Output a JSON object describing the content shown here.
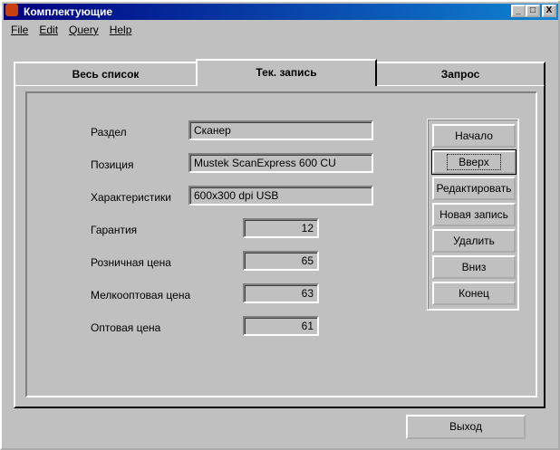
{
  "window": {
    "title": "Комплектующие",
    "minimize": "_",
    "maximize": "□",
    "close": "X"
  },
  "menu": [
    "File",
    "Edit",
    "Query",
    "Help"
  ],
  "tabs": [
    "Весь список",
    "Тек. запись",
    "Запрос"
  ],
  "fields": {
    "section": {
      "label": "Раздел",
      "value": "Сканер"
    },
    "position": {
      "label": "Позиция",
      "value": "Mustek ScanExpress 600 CU"
    },
    "specs": {
      "label": "Характеристики",
      "value": "600x300 dpi USB"
    },
    "warranty": {
      "label": "Гарантия",
      "value": "12"
    },
    "retail": {
      "label": "Розничная цена",
      "value": "65"
    },
    "smallwholesale": {
      "label": "Мелкооптовая цена",
      "value": "63"
    },
    "wholesale": {
      "label": "Оптовая цена",
      "value": "61"
    }
  },
  "buttons": [
    "Начало",
    "Вверх",
    "Редактировать",
    "Новая запись",
    "Удалить",
    "Вниз",
    "Конец"
  ],
  "exit": "Выход"
}
